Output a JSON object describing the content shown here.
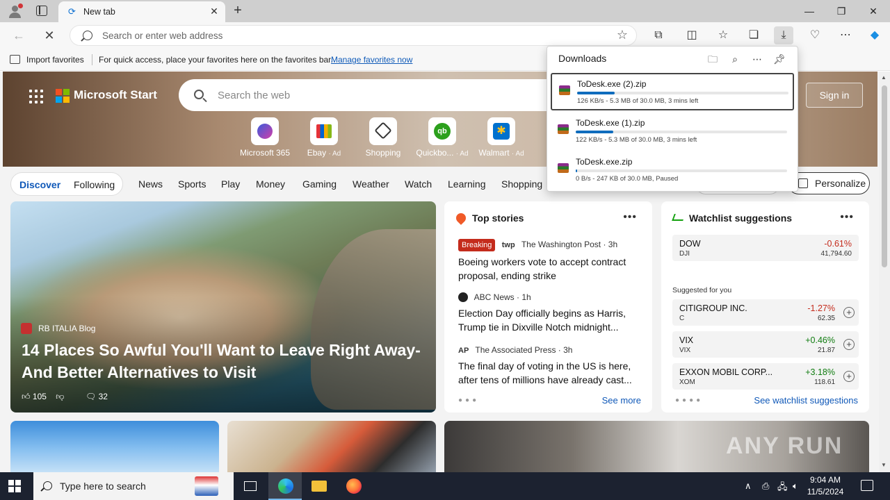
{
  "browser": {
    "tab_title": "New tab",
    "address_placeholder": "Search or enter web address"
  },
  "favorites_bar": {
    "import_label": "Import favorites",
    "hint": "For quick access, place your favorites here on the favorites bar.",
    "manage_link": "Manage favorites now"
  },
  "downloads": {
    "title": "Downloads",
    "items": [
      {
        "name": "ToDesk.exe (2).zip",
        "status": "126 KB/s - 5.3 MB of 30.0 MB, 3 mins left",
        "progress": 0.176
      },
      {
        "name": "ToDesk.exe (1).zip",
        "status": "122 KB/s - 5.3 MB of 30.0 MB, 3 mins left",
        "progress": 0.176
      },
      {
        "name": "ToDesk.exe.zip",
        "status": "0 B/s - 247 KB of 30.0 MB, Paused",
        "progress": 0.008
      }
    ]
  },
  "start_page": {
    "brand": "Microsoft Start",
    "search_placeholder": "Search the web",
    "sign_in": "Sign in",
    "quick_links": [
      {
        "label": "Microsoft 365",
        "ad": ""
      },
      {
        "label": "Ebay",
        "ad": "· Ad"
      },
      {
        "label": "Shopping",
        "ad": ""
      },
      {
        "label": "Quickbo...",
        "ad": "· Ad"
      },
      {
        "label": "Walmart",
        "ad": "· Ad"
      }
    ],
    "nav": {
      "discover": "Discover",
      "following": "Following",
      "links": [
        "News",
        "Sports",
        "Play",
        "Money",
        "Gaming",
        "Weather",
        "Watch",
        "Learning",
        "Shopping"
      ],
      "personalize": "Personalize"
    },
    "hero": {
      "source": "RB ITALIA Blog",
      "headline": "14 Places So Awful You'll Want to Leave Right Away- And Better Alternatives to Visit",
      "likes": "105",
      "comments": "32"
    },
    "top_stories": {
      "title": "Top stories",
      "stories": [
        {
          "badge": "Breaking",
          "logo": "twp",
          "source": "The Washington Post · 3h",
          "title": "Boeing workers vote to accept contract proposal, ending strike"
        },
        {
          "badge": "",
          "logo": "",
          "source": "ABC News · 1h",
          "title": "Election Day officially begins as Harris, Trump tie in Dixville Notch midnight..."
        },
        {
          "badge": "",
          "logo": "AP",
          "source": "The Associated Press · 3h",
          "title": "The final day of voting in the US is here, after tens of millions have already cast..."
        }
      ],
      "see_more": "See more"
    },
    "watchlist": {
      "title": "Watchlist suggestions",
      "main": {
        "name": "DOW",
        "symbol": "DJI",
        "change": "-0.61%",
        "price": "41,794.60"
      },
      "suggested_label": "Suggested for you",
      "suggestions": [
        {
          "name": "CITIGROUP INC.",
          "symbol": "C",
          "change": "-1.27%",
          "price": "62.35",
          "direction": "neg"
        },
        {
          "name": "VIX",
          "symbol": "VIX",
          "change": "+0.46%",
          "price": "21.87",
          "direction": "pos"
        },
        {
          "name": "EXXON MOBIL CORP...",
          "symbol": "XOM",
          "change": "+3.18%",
          "price": "118.61",
          "direction": "pos"
        }
      ],
      "see_more": "See watchlist suggestions"
    }
  },
  "taskbar": {
    "search_placeholder": "Type here to search",
    "time": "9:04 AM",
    "date": "11/5/2024"
  },
  "watermark": "ANY RUN"
}
